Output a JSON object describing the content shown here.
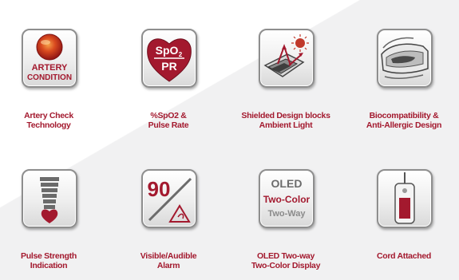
{
  "colors": {
    "accent": "#a3192e",
    "icon_gray": "#5a5a5a",
    "border": "#8e8e8e"
  },
  "features": [
    {
      "icon": "artery-condition-icon",
      "icon_text": [
        "ARTERY",
        "CONDITION"
      ],
      "label": [
        "Artery Check",
        "Technology"
      ]
    },
    {
      "icon": "spo2-heart-icon",
      "icon_text": [
        "SpO",
        "2",
        "PR"
      ],
      "label": [
        "%SpO2 &",
        "Pulse Rate"
      ]
    },
    {
      "icon": "shielded-sensor-icon",
      "icon_text": [],
      "label": [
        "Shielded Design blocks",
        "Ambient Light"
      ]
    },
    {
      "icon": "finger-clip-icon",
      "icon_text": [],
      "label": [
        "Biocompatibility &",
        "Anti-Allergic Design"
      ]
    },
    {
      "icon": "pulse-strength-bar-icon",
      "icon_text": [],
      "label": [
        "Pulse Strength",
        "Indication"
      ]
    },
    {
      "icon": "alarm-icon",
      "icon_text": [
        "90"
      ],
      "label": [
        "Visible/Audible",
        "Alarm"
      ]
    },
    {
      "icon": "oled-display-icon",
      "icon_text": [
        "OLED",
        "Two-Color",
        "Two-Way"
      ],
      "label": [
        "OLED Two-way",
        "Two-Color Display"
      ]
    },
    {
      "icon": "cord-attached-icon",
      "icon_text": [],
      "label": [
        "Cord Attached"
      ]
    }
  ]
}
